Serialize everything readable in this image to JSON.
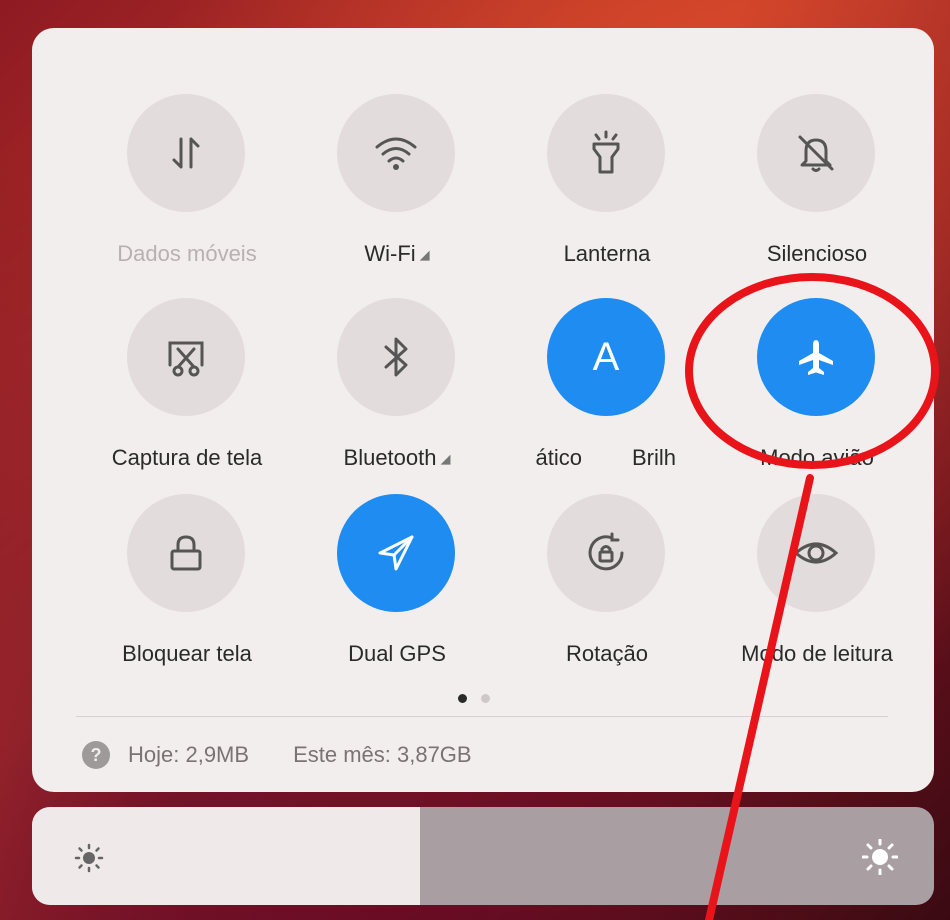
{
  "tiles": [
    {
      "label": "Dados móveis",
      "icon": "data-arrows-icon",
      "active": false,
      "dim": true
    },
    {
      "label": "Wi-Fi",
      "icon": "wifi-icon",
      "active": false,
      "signal": true
    },
    {
      "label": "Lanterna",
      "icon": "flashlight-icon",
      "active": false
    },
    {
      "label": "Silencioso",
      "icon": "bell-off-icon",
      "active": false
    },
    {
      "label": "Captura de tela",
      "icon": "screenshot-icon",
      "active": false
    },
    {
      "label": "Bluetooth",
      "icon": "bluetooth-icon",
      "active": false,
      "signal": true
    },
    {
      "label": "ático",
      "icon": "auto-brightness-icon",
      "active": true,
      "glyph": "A"
    },
    {
      "label": "Brilh",
      "icon": "none"
    },
    {
      "label": "Modo avião",
      "icon": "airplane-icon",
      "active": true
    },
    {
      "label": "Bloquear tela",
      "icon": "lock-icon",
      "active": false
    },
    {
      "label": "Dual GPS",
      "icon": "gps-arrow-icon",
      "active": true
    },
    {
      "label": "Rotação",
      "icon": "rotation-lock-icon",
      "active": false
    },
    {
      "label": "Modo de leitura",
      "icon": "eye-icon",
      "active": false
    }
  ],
  "usage": {
    "today": "Hoje: 2,9MB",
    "month": "Este mês: 3,87GB",
    "help": "?"
  },
  "brightness": {
    "level": 0.43
  },
  "colors": {
    "accent": "#1e8cf0",
    "annotation": "#e8141a"
  }
}
